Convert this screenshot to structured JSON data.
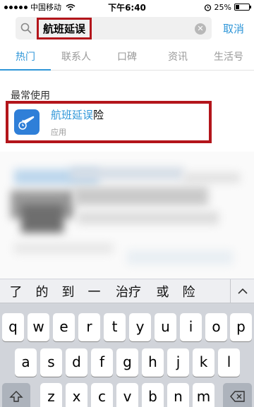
{
  "status": {
    "carrier": "中国移动",
    "time": "下午6:40",
    "battery": "25%",
    "battery_level": 0.25
  },
  "search": {
    "query": "航班延误",
    "cancel": "取消"
  },
  "tabs": [
    "热门",
    "联系人",
    "口碑",
    "资讯",
    "生活号"
  ],
  "recent": {
    "title": "最常使用",
    "app_name_highlight": "航班延误",
    "app_name_rest": "险",
    "app_type": "应用"
  },
  "suggestions": [
    "了",
    "的",
    "到",
    "一",
    "治疗",
    "或",
    "险"
  ],
  "keyboard": {
    "row1": [
      "q",
      "w",
      "e",
      "r",
      "t",
      "y",
      "u",
      "i",
      "o",
      "p"
    ],
    "row2": [
      "a",
      "s",
      "d",
      "f",
      "g",
      "h",
      "j",
      "k",
      "l"
    ],
    "row3": [
      "z",
      "x",
      "c",
      "v",
      "b",
      "n",
      "m"
    ]
  },
  "colors": {
    "accent": "#2f96d8",
    "highlight_border": "#b3151b"
  }
}
